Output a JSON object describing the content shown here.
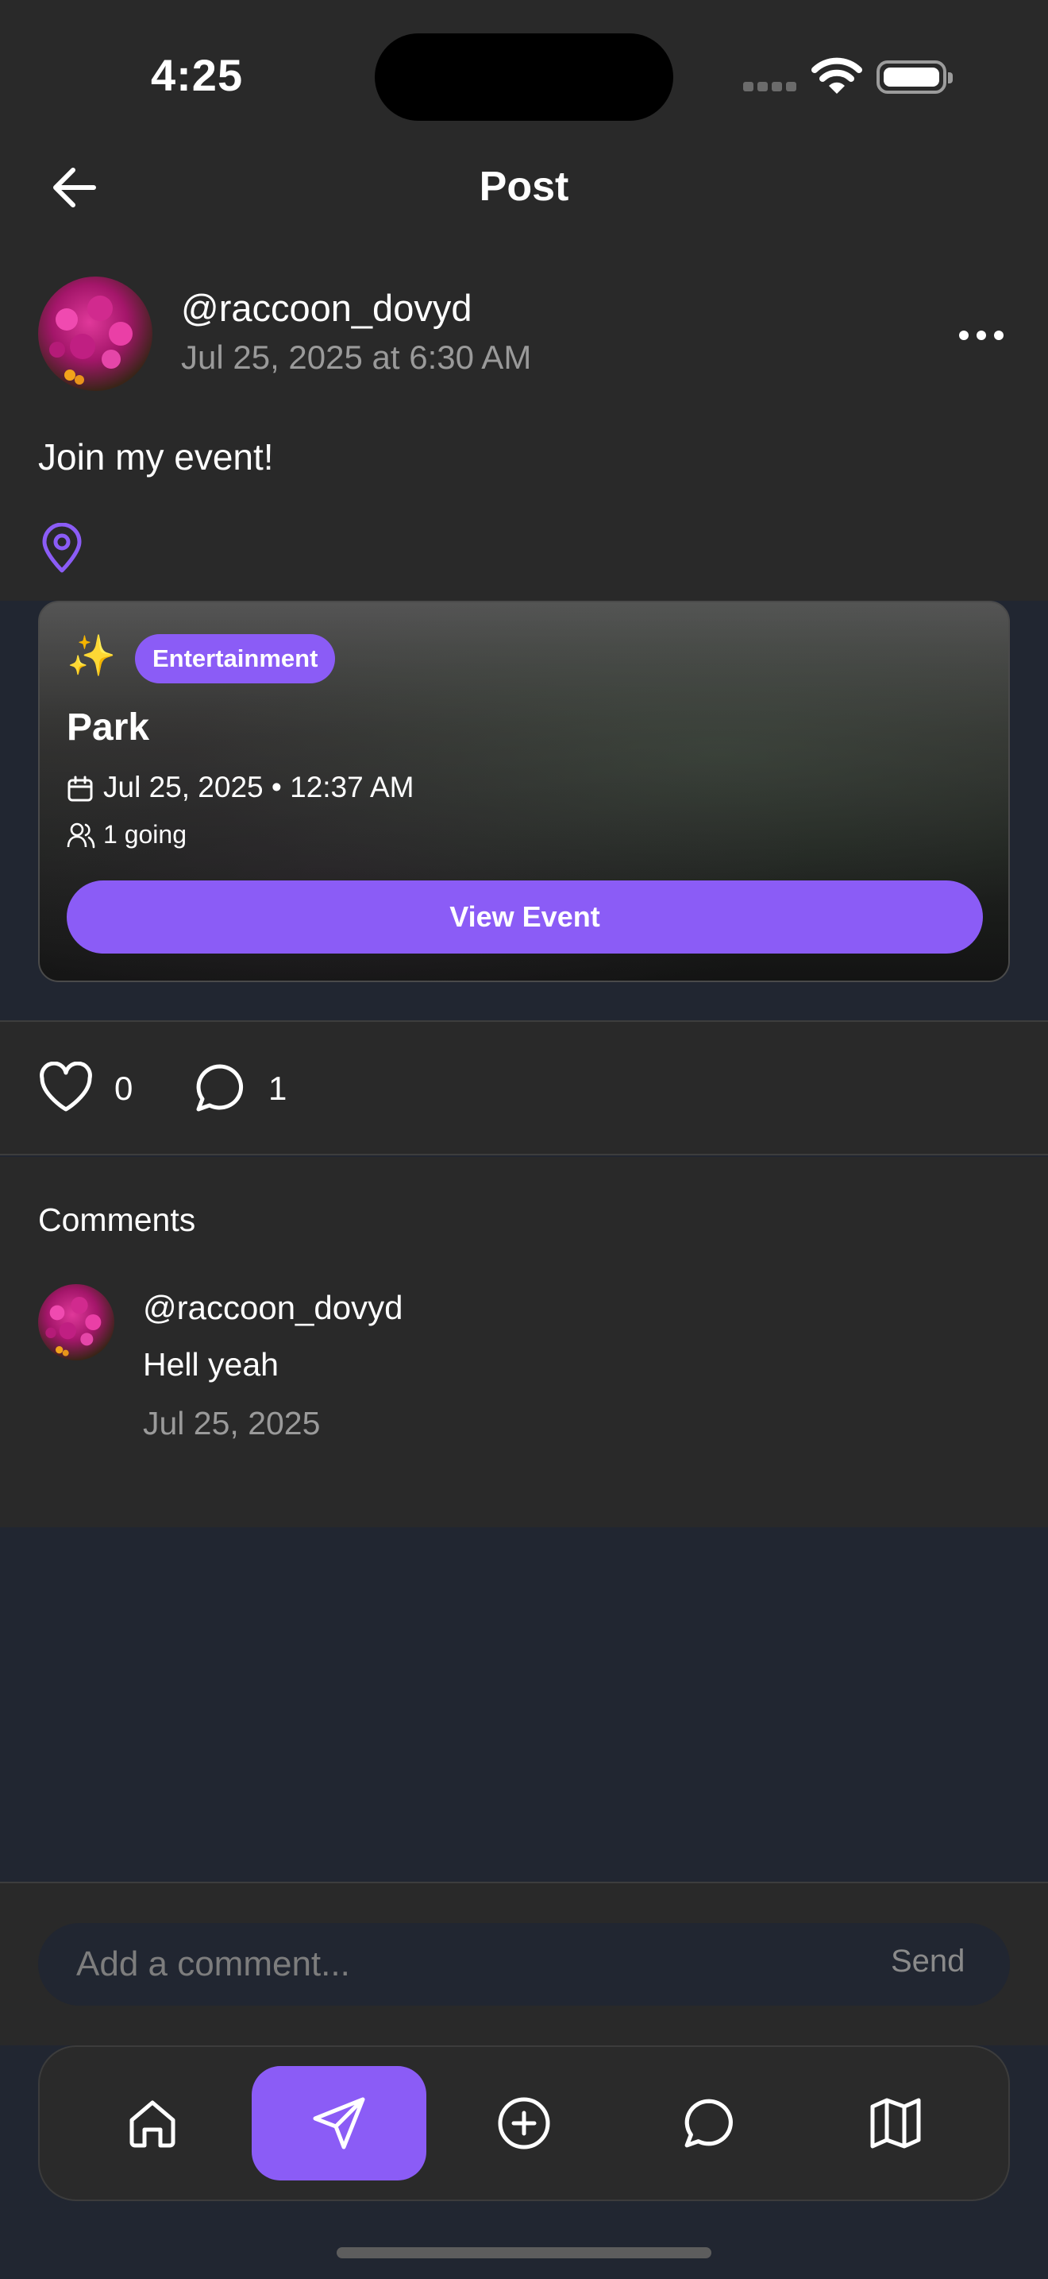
{
  "status_bar": {
    "time": "4:25"
  },
  "header": {
    "title": "Post",
    "back_icon": "arrow-left-icon"
  },
  "post": {
    "author": "@raccoon_dovyd",
    "date": "Jul 25, 2025 at 6:30 AM",
    "text": "Join my event!",
    "more_icon": "ellipsis-icon",
    "location_icon": "map-pin-icon",
    "event": {
      "emoji": "✨",
      "category": "Entertainment",
      "title": "Park",
      "datetime": "Jul 25, 2025 • 12:37 AM",
      "going": "1 going",
      "button_label": "View Event"
    },
    "likes": "0",
    "comments_count": "1"
  },
  "comments": {
    "title": "Comments",
    "items": [
      {
        "author": "@raccoon_dovyd",
        "text": "Hell yeah",
        "date": "Jul 25, 2025"
      }
    ]
  },
  "composer": {
    "placeholder": "Add a comment...",
    "send_label": "Send"
  },
  "tab_bar": {
    "items": [
      {
        "icon": "home-icon"
      },
      {
        "icon": "send-icon",
        "active": true
      },
      {
        "icon": "plus-circle-icon"
      },
      {
        "icon": "chat-bubble-icon"
      },
      {
        "icon": "map-icon"
      }
    ]
  },
  "colors": {
    "accent": "#8b5cf6",
    "panel": "#292929",
    "background": "#212631",
    "muted_text": "#9a9a9a"
  }
}
